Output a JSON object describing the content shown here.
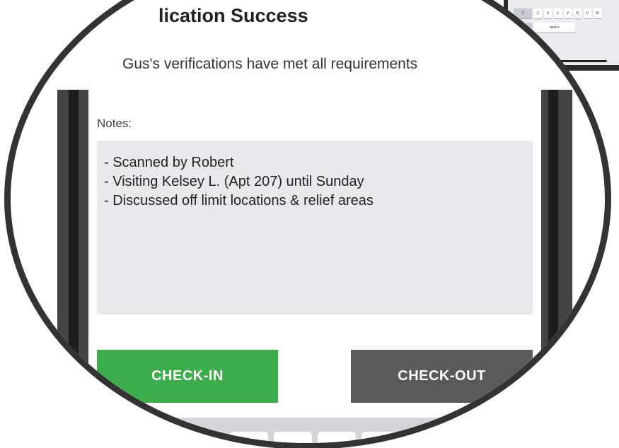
{
  "status": {
    "title": "lication Success",
    "message": "Gus's verifications have met all requirements"
  },
  "notes": {
    "label": "Notes:",
    "lines": [
      "- Scanned by Robert",
      "- Visiting Kelsey L. (Apt 207) until Sunday",
      "- Discussed off limit locations & relief areas"
    ]
  },
  "actions": {
    "checkin_label": "CHECK-IN",
    "checkout_label": "CHECK-OUT"
  },
  "keyboard": {
    "mini_row_keys": [
      "z",
      "x",
      "c",
      "v",
      "b",
      "n",
      "m"
    ],
    "mini_space_label": "space"
  },
  "colors": {
    "checkin": "#3cad4b",
    "checkout": "#595a5c",
    "notes_bg": "#e9e9ed",
    "lens_border": "#333333"
  }
}
